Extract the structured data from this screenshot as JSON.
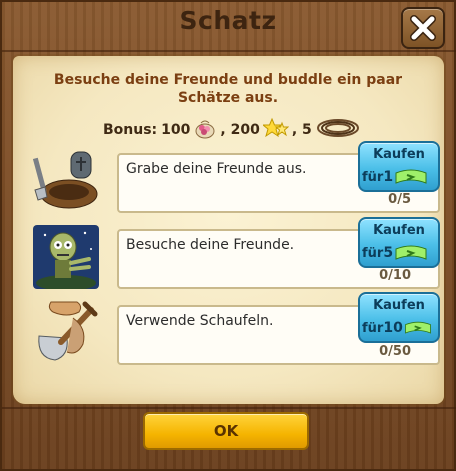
{
  "dialog": {
    "title": "Schatz",
    "intro": "Besuche deine Freunde und buddle ein paar Schätze aus.",
    "bonus": {
      "label": "Bonus:",
      "coins": "100",
      "flowers": ", 200",
      "stars": ", 5"
    },
    "tasks": [
      {
        "text": "Grabe deine Freunde aus.",
        "progress": "0/5",
        "buy_label": "Kaufen",
        "buy_for": "für",
        "buy_cost": "1"
      },
      {
        "text": "Besuche deine Freunde.",
        "progress": "0/10",
        "buy_label": "Kaufen",
        "buy_for": "für",
        "buy_cost": "5"
      },
      {
        "text": "Verwende Schaufeln.",
        "progress": "0/50",
        "buy_label": "Kaufen",
        "buy_for": "für",
        "buy_cost": "10"
      }
    ],
    "ok_label": "OK"
  },
  "icons": {
    "close": "close-x-icon",
    "bonus": [
      "coin-bag-icon",
      "flower-icon",
      "star-icon",
      "rope-icon"
    ],
    "tasks": [
      "grave-icon",
      "zombie-icon",
      "shovel-bag-icon"
    ],
    "currency": "cash-bill-icon"
  },
  "colors": {
    "wood": "#7a4b24",
    "parchment": "#f5e8c1",
    "intro_text": "#7b3f12",
    "buy_button": "#4bbfe8",
    "ok_button": "#f5b400"
  }
}
